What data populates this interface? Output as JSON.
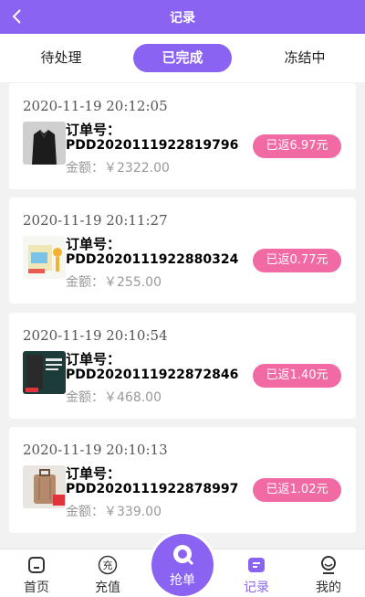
{
  "header": {
    "title": "记录"
  },
  "tabs": [
    {
      "label": "待处理"
    },
    {
      "label": "已完成"
    },
    {
      "label": "冻结中"
    }
  ],
  "orders": [
    {
      "time": "2020-11-19 20:12:05",
      "label": "订单号：",
      "number": "PDD2020111922819796",
      "amount": "金额：￥2322.00",
      "status": "已返6.97元",
      "thumb": "black-shirt-image"
    },
    {
      "time": "2020-11-19 20:11:27",
      "label": "订单号：",
      "number": "PDD2020111922880324",
      "amount": "金额：￥255.00",
      "status": "已返0.77元",
      "thumb": "toy-product-image"
    },
    {
      "time": "2020-11-19 20:10:54",
      "label": "订单号：",
      "number": "PDD2020111922872846",
      "amount": "金额：￥468.00",
      "status": "已返1.40元",
      "thumb": "device-product-image"
    },
    {
      "time": "2020-11-19 20:10:13",
      "label": "订单号：",
      "number": "PDD2020111922878997",
      "amount": "金额：￥339.00",
      "status": "已返1.02元",
      "thumb": "suitcase-product-image"
    }
  ],
  "nav": [
    {
      "label": "首页",
      "icon": "home-icon"
    },
    {
      "label": "充值",
      "icon": "recharge-icon",
      "glyph": "充"
    },
    {
      "label": "抢单",
      "icon": "grab-order-icon"
    },
    {
      "label": "记录",
      "icon": "record-icon"
    },
    {
      "label": "我的",
      "icon": "profile-icon"
    }
  ],
  "colors": {
    "accent": "#8a63f3",
    "status": "#f16aa3"
  }
}
